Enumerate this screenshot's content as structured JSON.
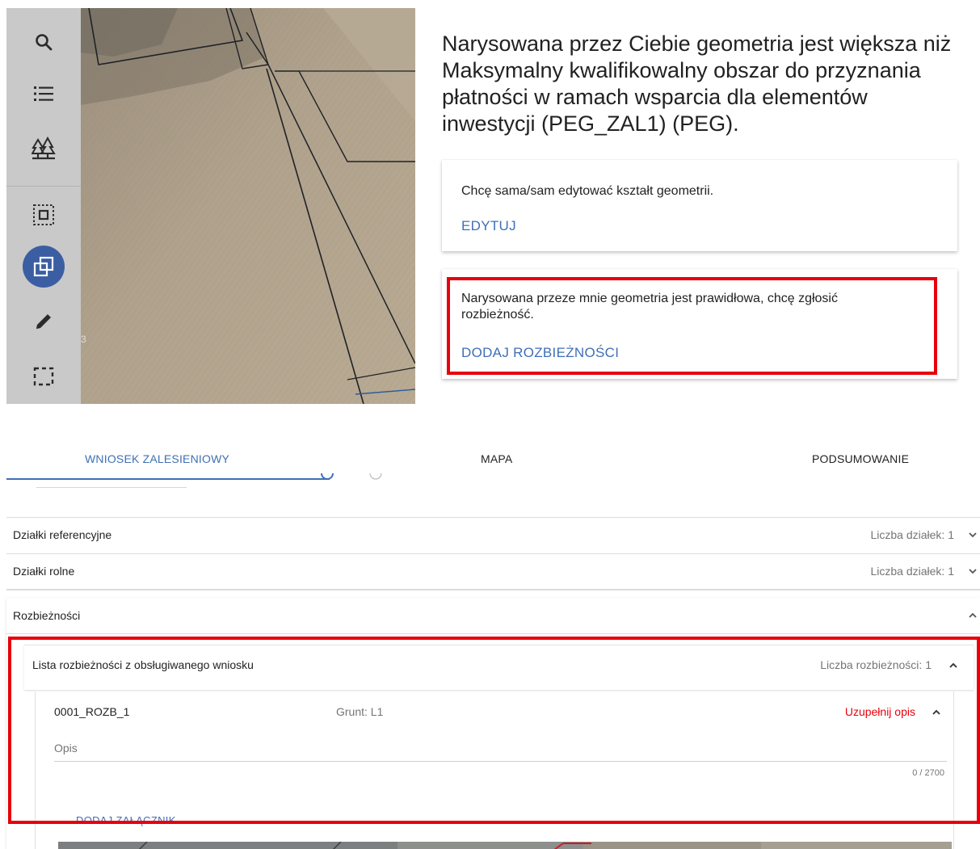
{
  "toolbar": {
    "tools": [
      {
        "icon": "search-icon"
      },
      {
        "icon": "layers-list-icon"
      },
      {
        "icon": "forest-icon"
      },
      {
        "icon": "select-area-icon"
      },
      {
        "icon": "copy-geometry-icon"
      },
      {
        "icon": "pencil-icon"
      },
      {
        "icon": "dashed-rectangle-icon"
      }
    ],
    "active_color": "#3b5ea3"
  },
  "map": {
    "parcel_label": "3"
  },
  "dialog": {
    "message": "Narysowana przez Ciebie geometria jest większa niż Maksymalny kwalifikowalny obszar do przyznania płatności w ramach wsparcia dla elementów inwestycji (PEG_ZAL1) (PEG).",
    "edit_option": {
      "text": "Chcę sama/sam edytować kształt geometrii.",
      "action": "EDYTUJ"
    },
    "discrepancy_option": {
      "text": "Narysowana przeze mnie geometria jest prawidłowa, chcę zgłosić rozbieżność.",
      "action": "DODAJ ROZBIEŻNOŚCI"
    }
  },
  "tabs": [
    {
      "label": "WNIOSEK ZALESIENIOWY",
      "active": true
    },
    {
      "label": "MAPA",
      "active": false
    },
    {
      "label": "PODSUMOWANIE",
      "active": false
    }
  ],
  "sections": {
    "referencyjne": {
      "label": "Działki referencyjne",
      "count": "Liczba działek: 1"
    },
    "rolne": {
      "label": "Działki rolne",
      "count": "Liczba działek: 1"
    },
    "rozbieznosci": {
      "label": "Rozbieżności",
      "list": {
        "title": "Lista rozbieżności z obsługiwanego wniosku",
        "count": "Liczba rozbieżności: 1"
      },
      "item": {
        "id": "0001_ROZB_1",
        "grunt": "Grunt: L1",
        "status": "Uzupełnij opis",
        "opis_label": "Opis",
        "counter": "0 / 2700",
        "add_attachment": "DODAJ ZAŁĄCZNIK"
      }
    }
  },
  "colors": {
    "accent": "#3f6fb6",
    "highlight": "#e8000b",
    "status_warning": "#e8000b"
  }
}
